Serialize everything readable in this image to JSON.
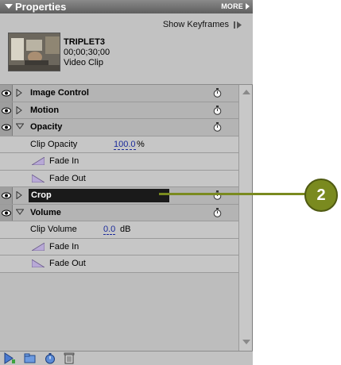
{
  "panel": {
    "title": "Properties",
    "more_label": "MORE",
    "show_keyframes_label": "Show Keyframes"
  },
  "clip": {
    "name": "TRIPLET3",
    "timecode": "00;00;30;00",
    "type": "Video Clip"
  },
  "effects": {
    "image_control": "Image Control",
    "motion": "Motion",
    "opacity": "Opacity",
    "clip_opacity_label": "Clip Opacity",
    "clip_opacity_value": "100.0",
    "clip_opacity_unit": "%",
    "fade_in": "Fade In",
    "fade_out": "Fade Out",
    "crop": "Crop",
    "volume": "Volume",
    "clip_volume_label": "Clip Volume",
    "clip_volume_value": "0.0",
    "clip_volume_unit": "dB",
    "vol_fade_in": "Fade In",
    "vol_fade_out": "Fade Out"
  },
  "callout": {
    "number": "2"
  },
  "colors": {
    "accent": "#7a8a1f",
    "selected_bar": "#1a1a1a",
    "value_link": "#1a2a9a"
  },
  "icons": {
    "eye": "eye-icon",
    "twirl_closed": "twirl-right-icon",
    "twirl_open": "twirl-down-icon",
    "stopwatch": "stopwatch-icon",
    "fade_in": "fade-in-ramp-icon",
    "fade_out": "fade-out-ramp-icon",
    "trash": "trash-icon"
  }
}
